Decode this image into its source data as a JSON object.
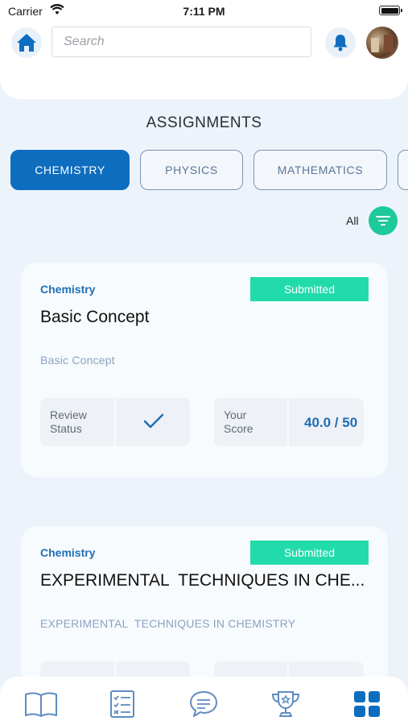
{
  "status_bar": {
    "carrier": "Carrier",
    "time": "7:11 PM"
  },
  "header": {
    "search_placeholder": "Search",
    "icons": [
      "home-icon",
      "bell-icon",
      "avatar"
    ]
  },
  "page": {
    "title": "ASSIGNMENTS"
  },
  "tabs": [
    {
      "label": "CHEMISTRY",
      "active": true
    },
    {
      "label": "PHYSICS",
      "active": false
    },
    {
      "label": "MATHEMATICS",
      "active": false
    }
  ],
  "filter": {
    "label": "All",
    "icon": "filter-icon"
  },
  "assignments": [
    {
      "subject": "Chemistry",
      "status": "Submitted",
      "title": "Basic Concept",
      "description": "Basic Concept",
      "review_label": "Review\nStatus",
      "review_icon": "check-icon",
      "score_label": "Your\nScore",
      "score": "40.0 / 50"
    },
    {
      "subject": "Chemistry",
      "status": "Submitted",
      "title": "EXPERIMENTAL  TECHNIQUES IN CHE...",
      "description": "EXPERIMENTAL  TECHNIQUES IN CHEMISTRY"
    }
  ],
  "bottom_nav": {
    "items": [
      "book-icon",
      "checklist-icon",
      "chat-icon",
      "trophy-icon",
      "grid-icon"
    ],
    "active": "grid-icon"
  },
  "colors": {
    "primary": "#0d6dbf",
    "accent": "#1ec99a",
    "badge": "#22dbaa",
    "background": "#edf3fa"
  }
}
